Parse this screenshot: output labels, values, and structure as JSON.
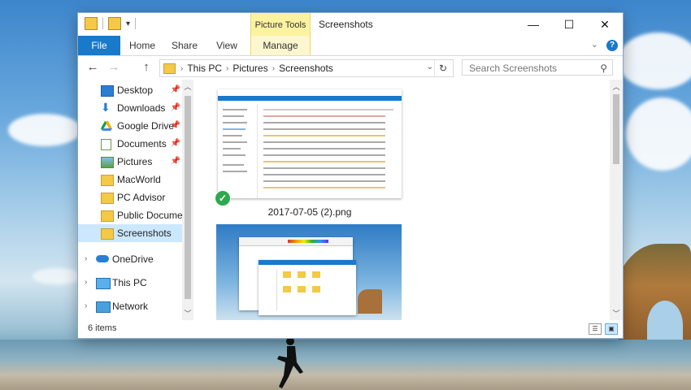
{
  "window": {
    "title": "Screenshots",
    "context_tab_group": "Picture Tools",
    "controls": {
      "minimize": "—",
      "maximize": "☐",
      "close": "✕"
    }
  },
  "quick_access_toolbar": {
    "dropdown": "▾"
  },
  "ribbon": {
    "tabs": [
      "File",
      "Home",
      "Share",
      "View",
      "Manage"
    ],
    "accent": "#1979ca",
    "context_color": "#fdf2a0",
    "help": "?",
    "collapse": "⌄"
  },
  "address_bar": {
    "back": "←",
    "forward": "→",
    "up": "↑",
    "breadcrumbs": [
      "This PC",
      "Pictures",
      "Screenshots"
    ],
    "dropdown": "⌄",
    "refresh": "↻"
  },
  "search": {
    "placeholder": "Search Screenshots",
    "icon": "search-icon"
  },
  "nav_pane": {
    "quick_access": [
      {
        "label": "Desktop",
        "icon": "desktop-icon",
        "pinned": true
      },
      {
        "label": "Downloads",
        "icon": "download-icon",
        "pinned": true
      },
      {
        "label": "Google Drive",
        "icon": "google-drive-icon",
        "pinned": true
      },
      {
        "label": "Documents",
        "icon": "documents-icon",
        "pinned": true
      },
      {
        "label": "Pictures",
        "icon": "pictures-icon",
        "pinned": true
      },
      {
        "label": "MacWorld",
        "icon": "folder-icon",
        "pinned": false
      },
      {
        "label": "PC Advisor",
        "icon": "folder-icon",
        "pinned": false
      },
      {
        "label": "Public Documents",
        "icon": "folder-icon",
        "pinned": false
      },
      {
        "label": "Screenshots",
        "icon": "folder-icon",
        "pinned": false,
        "selected": true
      }
    ],
    "roots": [
      {
        "label": "OneDrive",
        "icon": "onedrive-icon"
      },
      {
        "label": "This PC",
        "icon": "this-pc-icon"
      },
      {
        "label": "Network",
        "icon": "network-icon"
      }
    ],
    "pin_glyph": "📌"
  },
  "files": [
    {
      "name": "2017-07-05 (2).png",
      "selected": true
    },
    {
      "name": ""
    }
  ],
  "status_bar": {
    "item_count": "6 items"
  }
}
